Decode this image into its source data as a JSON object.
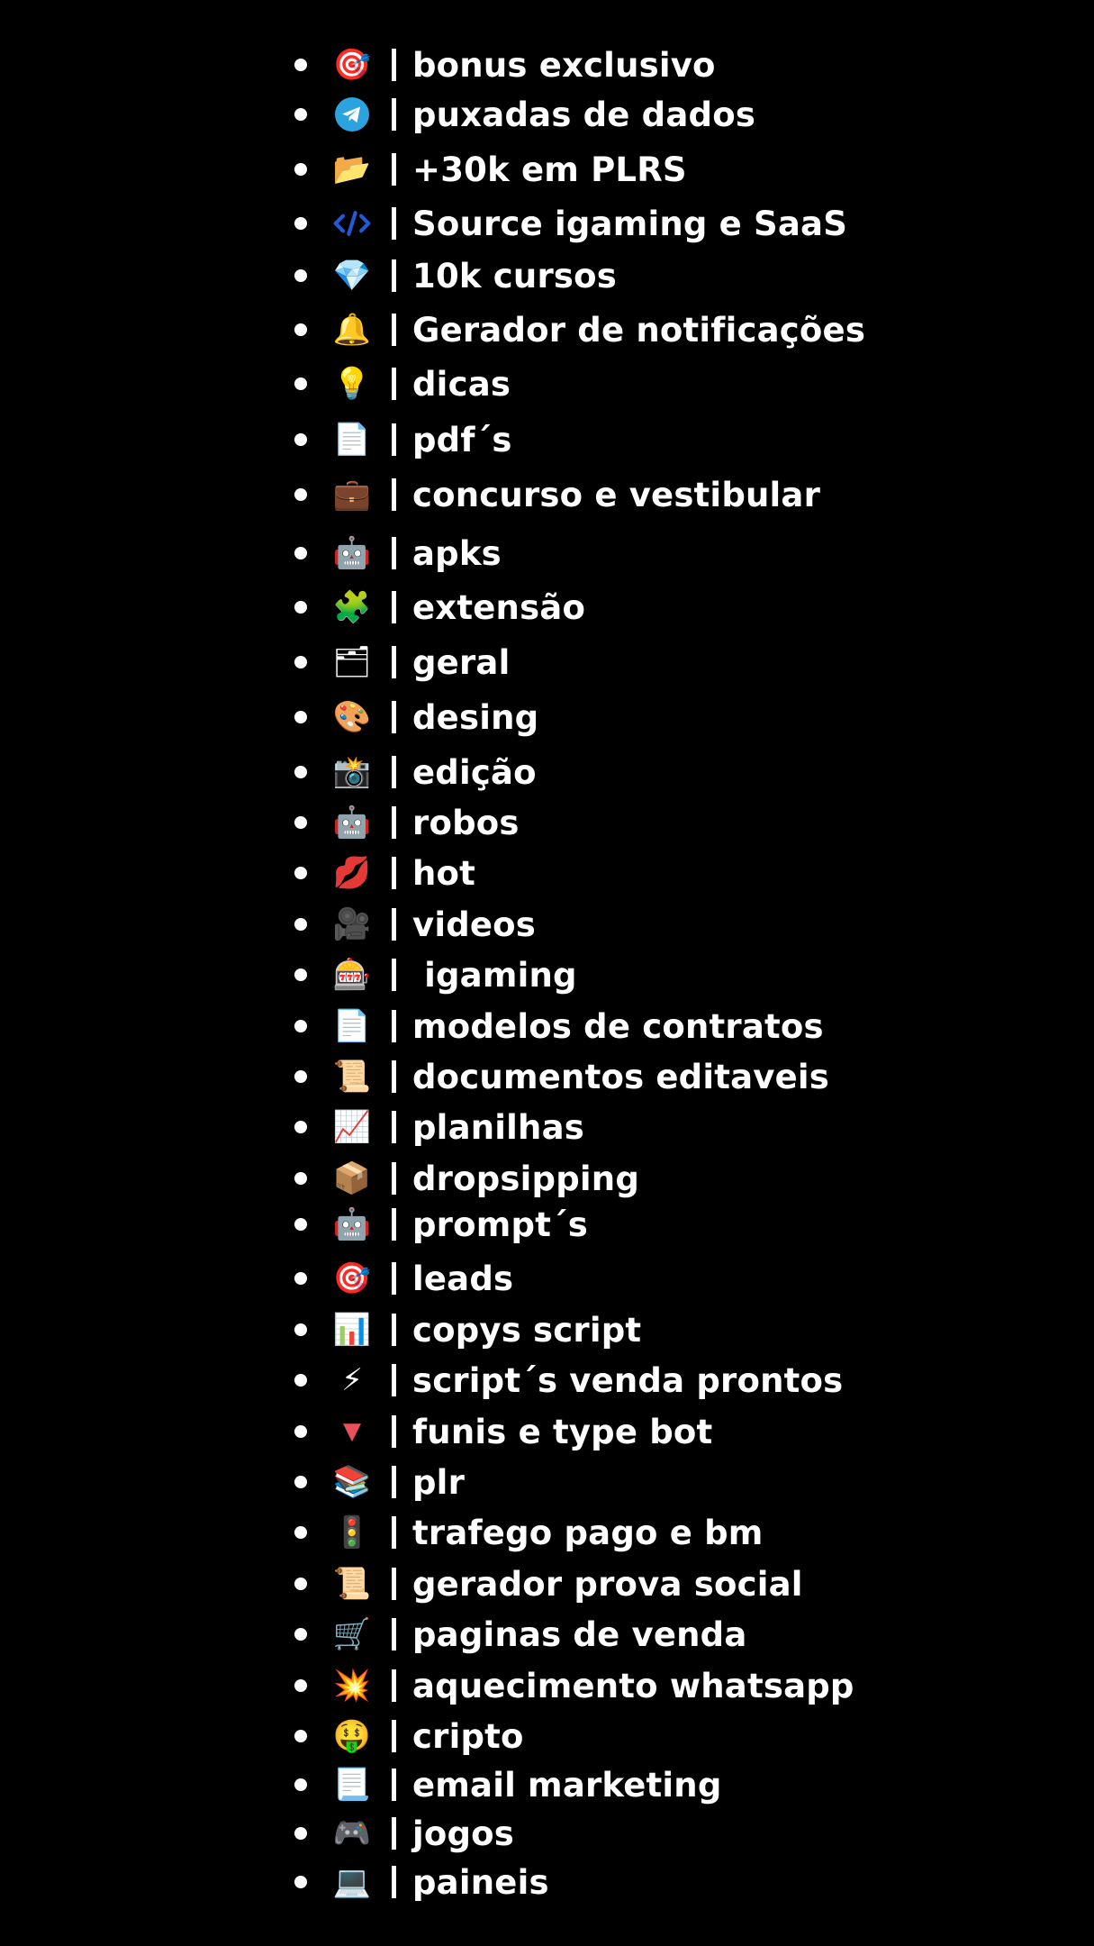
{
  "list": {
    "items": [
      {
        "icon": "🎯",
        "icon_name": "target-icon",
        "label": "bonus exclusivo"
      },
      {
        "icon": "✈",
        "icon_name": "telegram-icon",
        "label": "puxadas de dados"
      },
      {
        "icon": "📂",
        "icon_name": "folder-icon",
        "label": "+30k em PLRS"
      },
      {
        "icon": "</>",
        "icon_name": "code-icon",
        "label": "Source igaming e SaaS"
      },
      {
        "icon": "💎",
        "icon_name": "diamond-icon",
        "label": "10k cursos"
      },
      {
        "icon": "🔔",
        "icon_name": "bell-icon",
        "label": "Gerador de notificações"
      },
      {
        "icon": "💡",
        "icon_name": "lightbulb-icon",
        "label": "dicas"
      },
      {
        "icon": "📄",
        "icon_name": "document-icon",
        "label": "pdf´s"
      },
      {
        "icon": "💼",
        "icon_name": "briefcase-icon",
        "label": "concurso e vestibular"
      },
      {
        "icon": "🤖",
        "icon_name": "robot-icon",
        "label": "apks"
      },
      {
        "icon": "🧩",
        "icon_name": "puzzle-icon",
        "label": "extensão"
      },
      {
        "icon": "🗂",
        "icon_name": "card-index-icon",
        "label": "geral"
      },
      {
        "icon": "🎨",
        "icon_name": "palette-icon",
        "label": "desing"
      },
      {
        "icon": "📸",
        "icon_name": "camera-flash-icon",
        "label": "edição"
      },
      {
        "icon": "🤖",
        "icon_name": "robot-icon",
        "label": "robos"
      },
      {
        "icon": "💋",
        "icon_name": "lips-icon",
        "label": "hot"
      },
      {
        "icon": "🎥",
        "icon_name": "movie-camera-icon",
        "label": "videos"
      },
      {
        "icon": "🎰",
        "icon_name": "slot-machine-icon",
        "label": " igaming"
      },
      {
        "icon": "📄",
        "icon_name": "page-icon",
        "label": "modelos de contratos"
      },
      {
        "icon": "📜",
        "icon_name": "scroll-icon",
        "label": "documentos editaveis"
      },
      {
        "icon": "📈",
        "icon_name": "chart-up-icon",
        "label": "planilhas"
      },
      {
        "icon": "📦",
        "icon_name": "package-icon",
        "label": "dropsipping"
      },
      {
        "icon": "🤖",
        "icon_name": "robot-icon",
        "label": "prompt´s"
      },
      {
        "icon": "🎯",
        "icon_name": "target-icon",
        "label": "leads"
      },
      {
        "icon": "📊",
        "icon_name": "bar-chart-icon",
        "label": "copys script"
      },
      {
        "icon": "⚡",
        "icon_name": "lightning-icon",
        "label": "script´s venda prontos"
      },
      {
        "icon": "▼",
        "icon_name": "red-triangle-down-icon",
        "label": "funis e type bot"
      },
      {
        "icon": "📚",
        "icon_name": "books-icon",
        "label": "plr"
      },
      {
        "icon": "🚦",
        "icon_name": "traffic-light-icon",
        "label": "trafego pago e bm"
      },
      {
        "icon": "📜",
        "icon_name": "scroll-icon",
        "label": "gerador prova social"
      },
      {
        "icon": "🛒",
        "icon_name": "shopping-cart-icon",
        "label": "paginas de venda"
      },
      {
        "icon": "💥",
        "icon_name": "collision-icon",
        "label": "aquecimento whatsapp"
      },
      {
        "icon": "🤑",
        "icon_name": "money-face-icon",
        "label": "cripto"
      },
      {
        "icon": "📃",
        "icon_name": "curled-page-icon",
        "label": "email marketing"
      },
      {
        "icon": "🎮",
        "icon_name": "gamepad-icon",
        "label": "jogos"
      },
      {
        "icon": "💻",
        "icon_name": "computer-icon",
        "label": "paineis"
      }
    ]
  }
}
